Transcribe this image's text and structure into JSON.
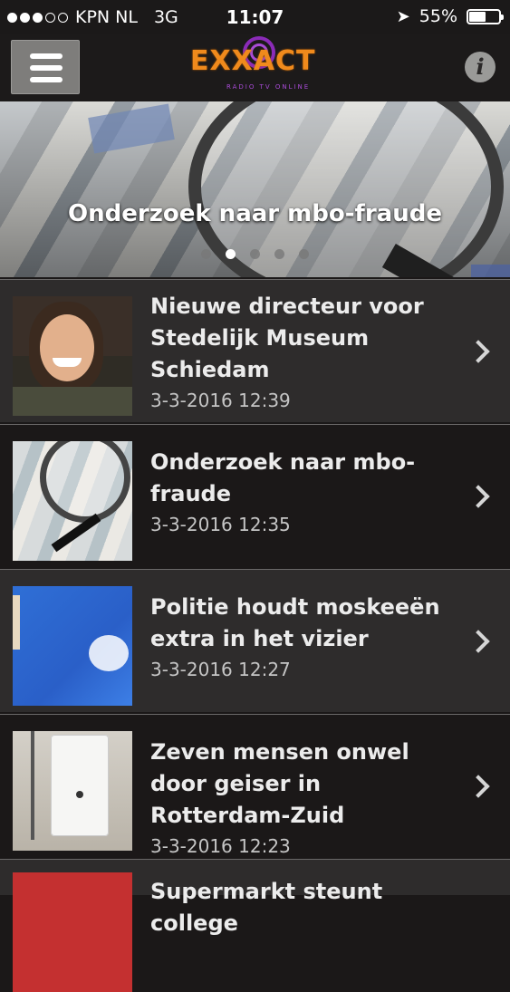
{
  "status_bar": {
    "carrier": "KPN NL",
    "network": "3G",
    "time": "11:07",
    "battery_percent": "55%",
    "battery_level": 0.55,
    "signal_bars_filled": 3,
    "signal_bars_total": 5
  },
  "header": {
    "logo_text": "EXXACT",
    "logo_tagline": "RADIO TV ONLINE",
    "menu_icon": "hamburger-icon",
    "info_icon": "info-icon",
    "info_glyph": "i"
  },
  "hero": {
    "title": "Onderzoek naar mbo-fraude",
    "page_count": 5,
    "active_page": 2
  },
  "articles": [
    {
      "title": "Nieuwe directeur voor Stedelijk Museum Schiedam",
      "date": "3-3-2016 12:39"
    },
    {
      "title": "Onderzoek naar mbo-fraude",
      "date": "3-3-2016 12:35"
    },
    {
      "title": "Politie houdt moskeeën extra in het vizier",
      "date": "3-3-2016 12:27"
    },
    {
      "title": "Zeven mensen onwel door geiser in Rotterdam-Zuid",
      "date": "3-3-2016 12:23"
    },
    {
      "title": "Supermarkt steunt college",
      "date": ""
    }
  ],
  "colors": {
    "background": "#1b1818",
    "row_light": "#2e2c2c",
    "logo_orange": "#f08a1c",
    "logo_purple": "#8b2bb8"
  }
}
